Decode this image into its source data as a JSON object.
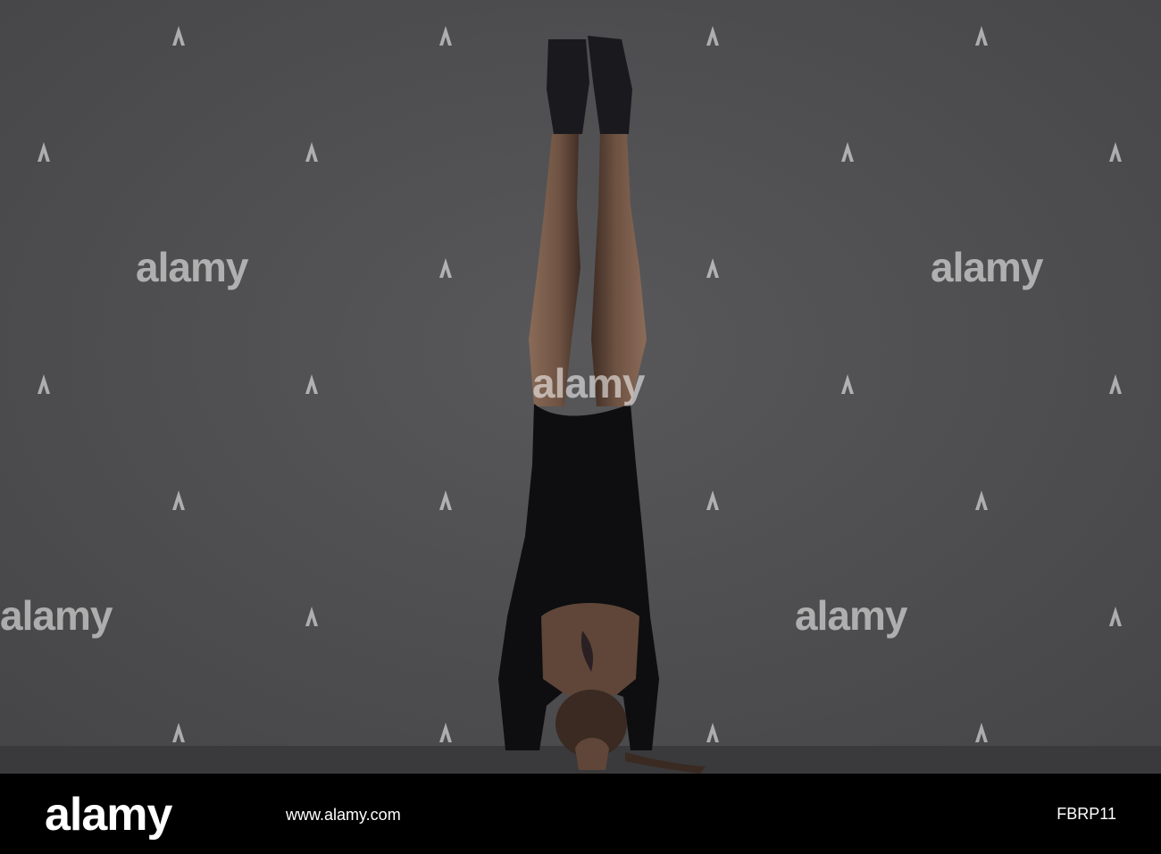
{
  "photo": {
    "subject": "woman-headstand",
    "colors": {
      "backdrop": "#4e4e50",
      "floor": "#3a3a3c",
      "bodysuit": "#0e0e10",
      "skin": "#7a5d4c",
      "boots": "#1a1a1e"
    }
  },
  "watermark": {
    "word": "alamy",
    "logo_icon": "alamy-a-logo-icon"
  },
  "footer": {
    "brand": "alamy",
    "caption": "www.alamy.com",
    "image_id": "FBRP11"
  }
}
